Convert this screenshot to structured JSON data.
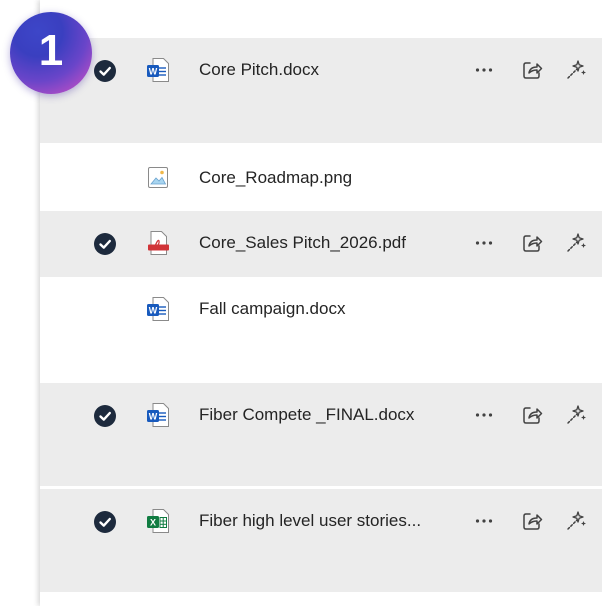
{
  "step_badge": {
    "number": "1"
  },
  "files": [
    {
      "name": "Core Pitch.docx",
      "type": "word",
      "selected": true
    },
    {
      "name": "Core_Roadmap.png",
      "type": "image",
      "selected": false
    },
    {
      "name": "Core_Sales Pitch_2026.pdf",
      "type": "pdf",
      "selected": true
    },
    {
      "name": "Fall campaign.docx",
      "type": "word",
      "selected": false
    },
    {
      "name": "Fiber Compete _FINAL.docx",
      "type": "word",
      "selected": true
    },
    {
      "name": "Fiber high level user stories...",
      "type": "excel",
      "selected": true
    }
  ],
  "row_actions": {
    "more_icon": "more-options-icon",
    "share_icon": "share-icon",
    "copilot_icon": "copilot-sparkle-icon"
  },
  "colors": {
    "selected_row_bg": "#ececec",
    "check_fill": "#1d2a3d",
    "word_blue": "#185abd",
    "excel_green": "#107c41",
    "pdf_red": "#d13438"
  }
}
